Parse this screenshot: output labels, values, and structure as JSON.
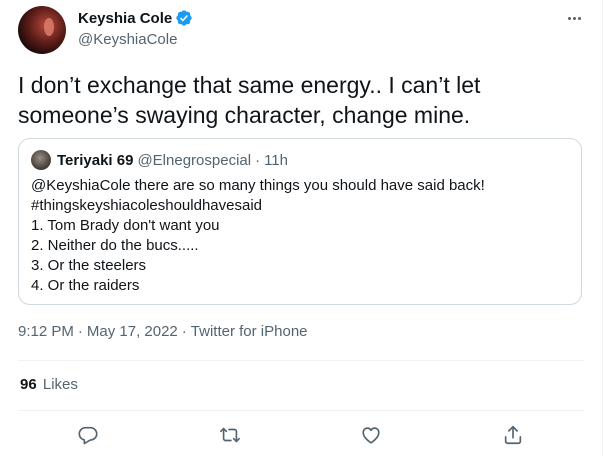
{
  "author": {
    "name": "Keyshia Cole",
    "handle": "@KeyshiaCole",
    "verified": true,
    "avatar_icon": "profile-photo"
  },
  "tweet": {
    "text": "I don’t exchange that same energy.. I can’t let someone’s swaying character, change mine."
  },
  "quoted_tweet": {
    "name": "Teriyaki 69",
    "handle": "@Elnegrospecial",
    "separator": "·",
    "time": "11h",
    "lines": [
      "@KeyshiaCole there are so many things you should have said back!",
      "#thingskeyshiacoleshouldhavesaid",
      "1. Tom Brady don't want you",
      "2. Neither do the bucs.....",
      "3. Or the steelers",
      "4. Or the raiders"
    ]
  },
  "meta": {
    "time": "9:12 PM",
    "sep1": "·",
    "date": "May 17, 2022",
    "sep2": "·",
    "source": "Twitter for iPhone"
  },
  "stats": {
    "likes_count": "96",
    "likes_label": "Likes"
  },
  "actions": [
    {
      "icon": "reply-icon"
    },
    {
      "icon": "retweet-icon"
    },
    {
      "icon": "like-icon"
    },
    {
      "icon": "share-icon"
    }
  ],
  "colors": {
    "text": "#0f1419",
    "secondary": "#536471",
    "verified": "#1d9bf0",
    "border": "#cfd9de",
    "divider": "#eff3f4"
  }
}
